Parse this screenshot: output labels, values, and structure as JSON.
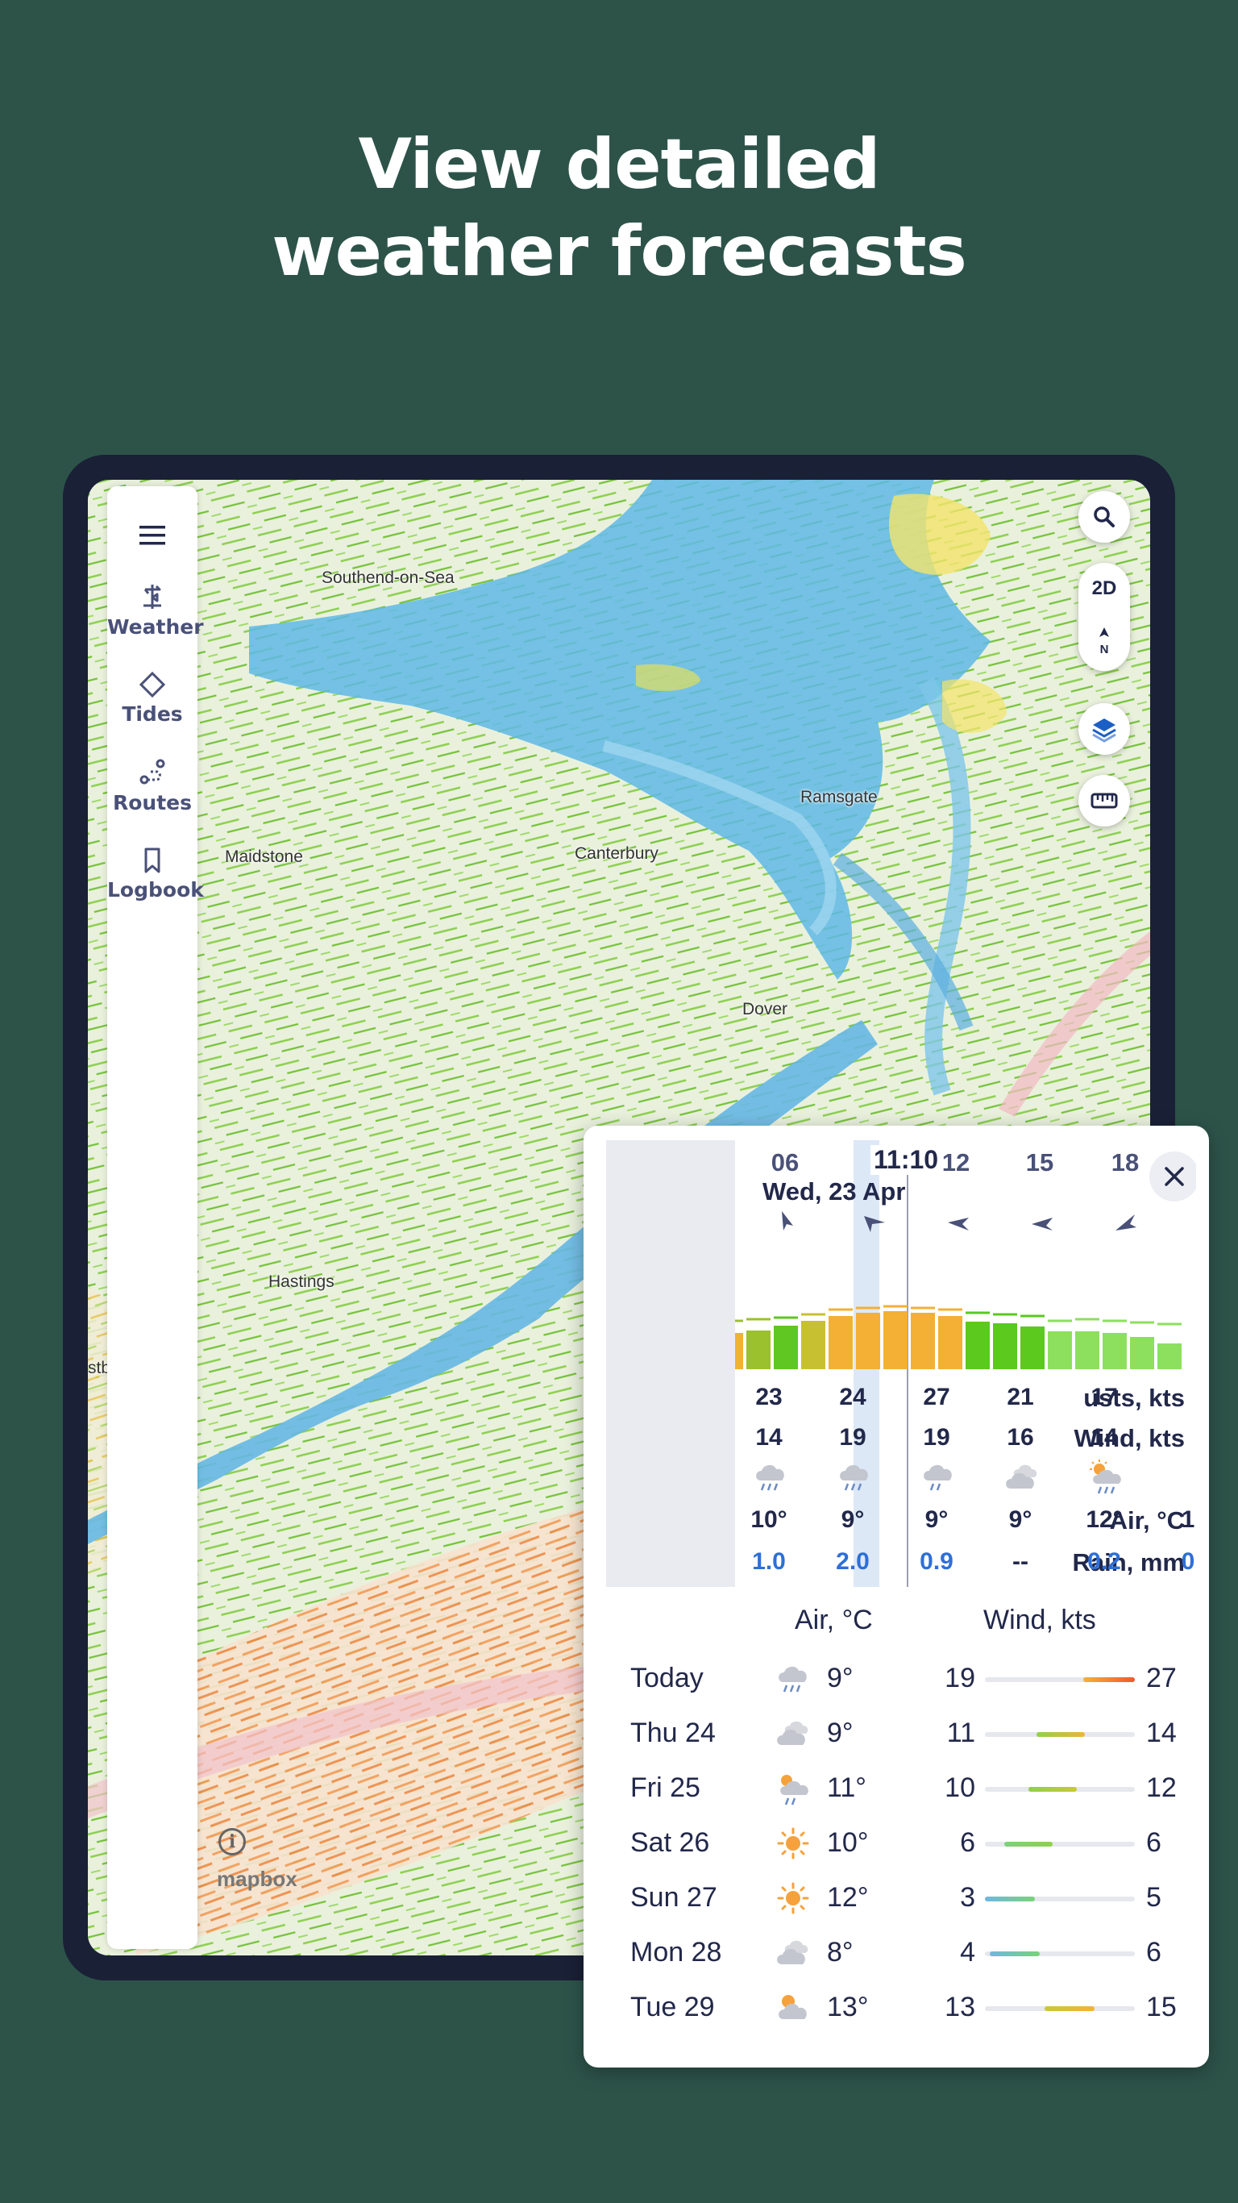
{
  "headline": {
    "line1": "View detailed",
    "line2": "weather forecasts"
  },
  "sidebar": {
    "items": [
      {
        "label": "Weather",
        "icon": "weathervane-icon"
      },
      {
        "label": "Tides",
        "icon": "diamond-icon"
      },
      {
        "label": "Routes",
        "icon": "route-icon"
      },
      {
        "label": "Logbook",
        "icon": "bookmark-icon"
      }
    ]
  },
  "map": {
    "mode_toggle": "2D",
    "north_label": "N",
    "places": [
      "Southend-on-Sea",
      "Maidstone",
      "Canterbury",
      "Ramsgate",
      "Dover",
      "Hastings",
      "stb"
    ],
    "attribution": "mapbox"
  },
  "hourly": {
    "current_time": "11:10",
    "current_date": "Wed, 23 Apr",
    "hours": [
      "06",
      "",
      "12",
      "15",
      "18"
    ],
    "row_labels": {
      "gusts": "usts, kts",
      "wind": "Wind, kts",
      "air": "Air, °C",
      "rain": "Rain, mm"
    },
    "columns": [
      {
        "gusts": "23",
        "wind": "14",
        "icon": "rain-icon",
        "air": "10°",
        "rain": "1.0"
      },
      {
        "gusts": "24",
        "wind": "19",
        "icon": "rain-icon",
        "air": "9°",
        "rain": "2.0"
      },
      {
        "gusts": "27",
        "wind": "19",
        "icon": "rain-icon",
        "air": "9°",
        "rain": "0.9"
      },
      {
        "gusts": "21",
        "wind": "16",
        "icon": "cloud-icon",
        "air": "9°",
        "rain": "--"
      },
      {
        "gusts": "17",
        "wind": "14",
        "icon": "sun-rain-icon",
        "air": "12°",
        "rain": "0.2"
      },
      {
        "gusts": "",
        "wind": "",
        "icon": "",
        "air": "1",
        "rain": "0"
      }
    ]
  },
  "daily": {
    "air_header": "Air, °C",
    "wind_header": "Wind, kts",
    "days": [
      {
        "name": "Today",
        "icon": "rain-icon",
        "temp": "9°",
        "wind_min": "19",
        "wind_max": "27"
      },
      {
        "name": "Thu 24",
        "icon": "cloud-icon",
        "temp": "9°",
        "wind_min": "11",
        "wind_max": "14"
      },
      {
        "name": "Fri 25",
        "icon": "sun-rain-icon",
        "temp": "11°",
        "wind_min": "10",
        "wind_max": "12"
      },
      {
        "name": "Sat 26",
        "icon": "sun-icon",
        "temp": "10°",
        "wind_min": "6",
        "wind_max": "6"
      },
      {
        "name": "Sun 27",
        "icon": "sun-icon",
        "temp": "12°",
        "wind_min": "3",
        "wind_max": "5"
      },
      {
        "name": "Mon 28",
        "icon": "cloud-icon",
        "temp": "8°",
        "wind_min": "4",
        "wind_max": "6"
      },
      {
        "name": "Tue 29",
        "icon": "sun-cloud-icon",
        "temp": "13°",
        "wind_min": "13",
        "wind_max": "15"
      }
    ]
  },
  "colors": {
    "background": "#2d5349",
    "navy": "#22284a",
    "rain_blue": "#2e6fd6"
  }
}
